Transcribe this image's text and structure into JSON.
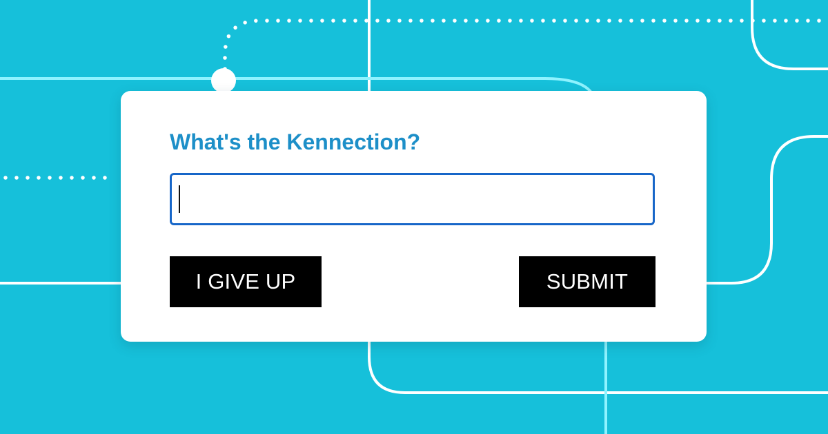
{
  "colors": {
    "background": "#16c0da",
    "background_line": "#ffffff",
    "background_line_accent": "#8ff3ff",
    "title": "#1d8fc8",
    "input_border": "#1766c8",
    "button_bg": "#000000",
    "button_text": "#ffffff"
  },
  "prompt": {
    "title": "What's the Kennection?"
  },
  "answer_input": {
    "value": "",
    "placeholder": ""
  },
  "buttons": {
    "give_up_label": "I GIVE UP",
    "submit_label": "SUBMIT"
  }
}
